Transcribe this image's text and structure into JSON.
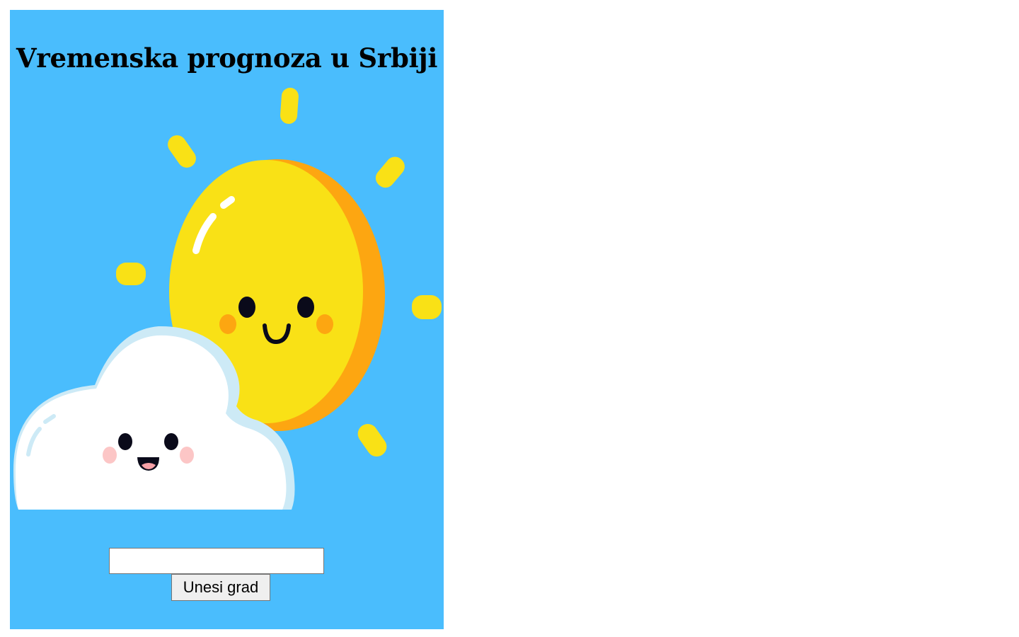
{
  "header": {
    "title": "Vremenska prognoza u Srbiji"
  },
  "illustration": {
    "icon": "sun-behind-cloud"
  },
  "form": {
    "city_value": "",
    "city_placeholder": "",
    "submit_label": "Unesi grad"
  },
  "colors": {
    "panel_background": "#4abdfd",
    "sun": "#f9e116",
    "sun_shade": "#fda611",
    "cloud": "#ffffff",
    "cloud_shade": "#cdeaf6"
  }
}
